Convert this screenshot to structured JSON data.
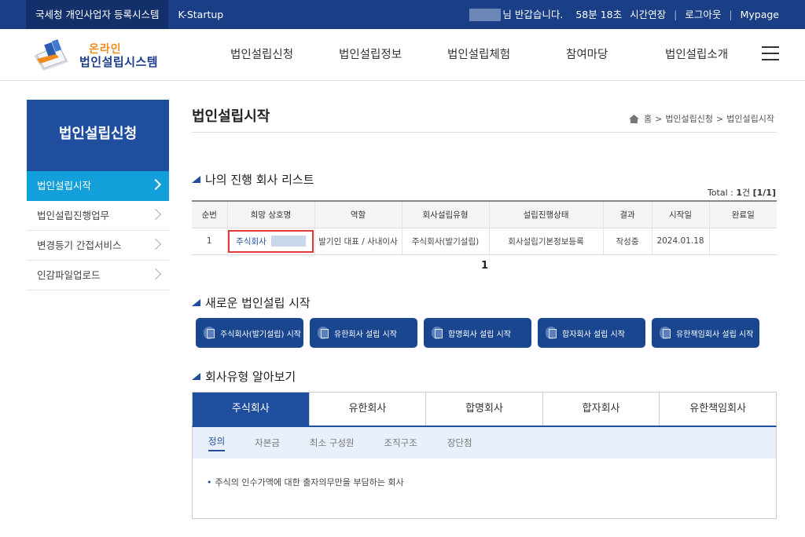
{
  "topbar": {
    "links": [
      "국세청 개인사업자 등록시스템",
      "K-Startup"
    ],
    "greeting": "님 반갑습니다.",
    "timer": "58분 18초",
    "extend": "시간연장",
    "logout": "로그아웃",
    "mypage": "Mypage"
  },
  "logo": {
    "line1": "온라인",
    "line2": "법인설립시스템"
  },
  "gnb": [
    "법인설립신청",
    "법인설립정보",
    "법인설립체험",
    "참여마당",
    "법인설립소개"
  ],
  "sidebar": {
    "title": "법인설립신청",
    "items": [
      "법인설립시작",
      "법인설립진행업무",
      "변경등기 간접서비스",
      "인감파일업로드"
    ]
  },
  "page": {
    "title": "법인설립시작",
    "breadcrumb": [
      "홈",
      "법인설립신청",
      "법인설립시작"
    ]
  },
  "progress_list": {
    "title": "나의 진행 회사 리스트",
    "total_label": "Total : ",
    "total_count": "1",
    "total_unit": "건 ",
    "total_pages": "[1/1]",
    "columns": [
      "순번",
      "희망 상호명",
      "역할",
      "회사설립유형",
      "설립진행상태",
      "결과",
      "시작일",
      "완료일"
    ],
    "rows": [
      {
        "no": "1",
        "company": "주식회사",
        "role": "발기인 대표 / 사내이사",
        "type": "주식회사(발기설립)",
        "status": "회사설립기본정보등록",
        "result": "작성중",
        "start": "2024.01.18",
        "end": ""
      }
    ],
    "page": "1"
  },
  "new_start": {
    "title": "새로운 법인설립 시작",
    "buttons": [
      "주식회사(발기설립) 시작",
      "유한회사 설립 시작",
      "합명회사 설립 시작",
      "합자회사 설립 시작",
      "유한책임회사 설립 시작"
    ]
  },
  "company_types": {
    "title": "회사유형 알아보기",
    "tabs": [
      "주식회사",
      "유한회사",
      "합명회사",
      "합자회사",
      "유한책임회사"
    ],
    "subtabs": [
      "정의",
      "자본금",
      "최소 구성원",
      "조직구조",
      "장단점"
    ],
    "definition": "주식의 인수가액에 대한 출자의무만을 부담하는 회사"
  },
  "colors": {
    "navy": "#1b3f86",
    "primary": "#1f4e9e",
    "active_sidebar": "#129fda",
    "orange": "#f08a1d",
    "highlight": "#e03a3a"
  }
}
